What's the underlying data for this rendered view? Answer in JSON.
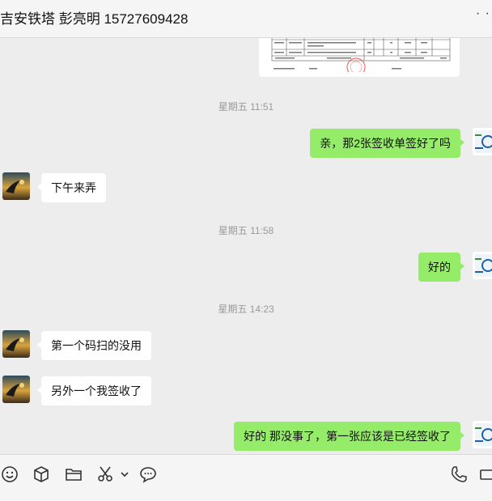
{
  "header": {
    "title": "吉安铁塔 彭亮明 15727609428",
    "more_icon": "more-icon"
  },
  "colors": {
    "sent_bubble": "#95ec69",
    "received_bubble": "#ffffff",
    "background": "#ededed",
    "timestamp": "#9a9a9a"
  },
  "messages": [
    {
      "type": "image",
      "direction": "in",
      "content": "signed-receipt-document-image"
    },
    {
      "type": "timestamp",
      "text": "星期五 11:51"
    },
    {
      "type": "text",
      "direction": "out",
      "text": "亲，那2张签收单签好了吗"
    },
    {
      "type": "text",
      "direction": "in",
      "text": "下午来弄"
    },
    {
      "type": "timestamp",
      "text": "星期五 11:58"
    },
    {
      "type": "text",
      "direction": "out",
      "text": "好的"
    },
    {
      "type": "timestamp",
      "text": "星期五 14:23"
    },
    {
      "type": "text",
      "direction": "in",
      "text": "第一个码扫的没用"
    },
    {
      "type": "text",
      "direction": "in",
      "text": "另外一个我签收了"
    },
    {
      "type": "text",
      "direction": "out",
      "text": "好的 那没事了，第一张应该是已经签收了"
    }
  ],
  "toolbar": {
    "icons": [
      "emoji-icon",
      "package-icon",
      "folder-icon",
      "scissors-icon",
      "chevron-down-icon",
      "chat-bubble-icon",
      "phone-icon",
      "video-icon"
    ]
  }
}
